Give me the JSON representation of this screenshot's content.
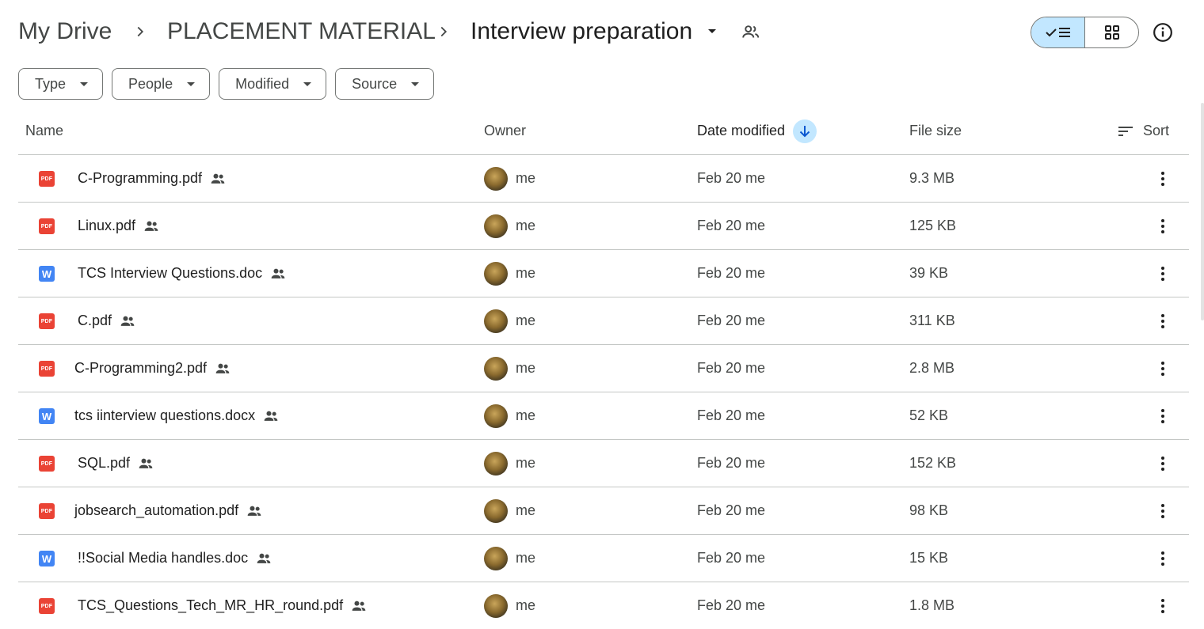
{
  "breadcrumb": {
    "root": "My Drive",
    "parent": "PLACEMENT MATERIAL",
    "current": "Interview preparation"
  },
  "icons": {
    "separator": "chevron-right-icon",
    "folder_menu": "caret-down-icon",
    "shared": "shared-people-icon",
    "list_view": "check-list-icon",
    "grid_view": "grid-icon",
    "info": "info-icon",
    "sort": "sort-lines-icon",
    "more": "more-vert-icon"
  },
  "view_toggle": {
    "active": "list"
  },
  "filters": [
    {
      "label": "Type"
    },
    {
      "label": "People"
    },
    {
      "label": "Modified"
    },
    {
      "label": "Source"
    }
  ],
  "table": {
    "headers": {
      "name": "Name",
      "owner": "Owner",
      "date_modified": "Date modified",
      "file_size": "File size",
      "sort": "Sort"
    },
    "rows": [
      {
        "name": "C-Programming.pdf",
        "type": "pdf",
        "type_label": "PDF",
        "owner": "me",
        "modified": "Feb 20 me",
        "size": "9.3 MB"
      },
      {
        "name": "Linux.pdf",
        "type": "pdf",
        "type_label": "PDF",
        "owner": "me",
        "modified": "Feb 20 me",
        "size": "125 KB"
      },
      {
        "name": "TCS Interview Questions.doc",
        "type": "doc",
        "type_label": "W",
        "owner": "me",
        "modified": "Feb 20 me",
        "size": "39 KB"
      },
      {
        "name": "C.pdf",
        "type": "pdf",
        "type_label": "PDF",
        "owner": "me",
        "modified": "Feb 20 me",
        "size": "311 KB"
      },
      {
        "name": "C-Programming2.pdf",
        "type": "pdf",
        "type_label": "PDF",
        "owner": "me",
        "modified": "Feb 20 me",
        "size": "2.8 MB"
      },
      {
        "name": "tcs iinterview questions.docx",
        "type": "doc",
        "type_label": "W",
        "owner": "me",
        "modified": "Feb 20 me",
        "size": "52 KB"
      },
      {
        "name": "SQL.pdf",
        "type": "pdf",
        "type_label": "PDF",
        "owner": "me",
        "modified": "Feb 20 me",
        "size": "152 KB"
      },
      {
        "name": "jobsearch_automation.pdf",
        "type": "pdf",
        "type_label": "PDF",
        "owner": "me",
        "modified": "Feb 20 me",
        "size": "98 KB"
      },
      {
        "name": "!!Social Media handles.doc",
        "type": "doc",
        "type_label": "W",
        "owner": "me",
        "modified": "Feb 20 me",
        "size": "15 KB"
      },
      {
        "name": "TCS_Questions_Tech_MR_HR_round.pdf",
        "type": "pdf",
        "type_label": "PDF",
        "owner": "me",
        "modified": "Feb 20 me",
        "size": "1.8 MB"
      }
    ]
  },
  "colors": {
    "accent": "#c2e7ff",
    "pdf": "#ea4335",
    "doc": "#4285f4",
    "divider": "#c4c7c5"
  }
}
